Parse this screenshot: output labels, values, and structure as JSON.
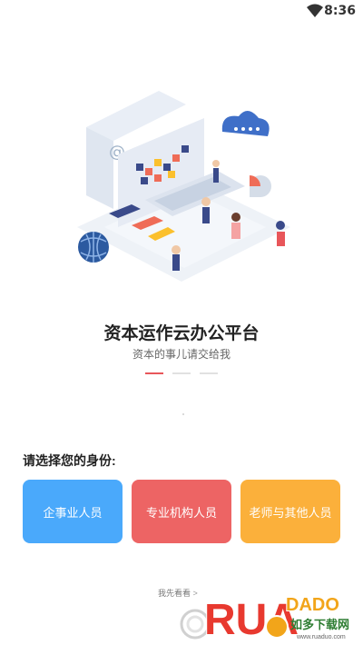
{
  "status_bar": {
    "time": "8:36",
    "wifi_icon": "wifi-icon"
  },
  "hero": {
    "title": "资本运作云办公平台",
    "subtitle": "资本的事儿请交给我"
  },
  "pager": {
    "count": 3,
    "active_index": 0
  },
  "identity": {
    "prompt": "请选择您的身份:",
    "options": [
      {
        "label": "企事业人员",
        "color": "#4aa9fb"
      },
      {
        "label": "专业机构人员",
        "color": "#ed6464"
      },
      {
        "label": "老师与其他人员",
        "color": "#fbb03b"
      }
    ]
  },
  "footer": {
    "skip_text": "我先看看",
    "skip_arrow": ">"
  },
  "watermark": {
    "brand": "RUANADAO",
    "sub": "如多下载网",
    "site": "www.ruaduo.com"
  },
  "colors": {
    "accent": "#e8565a",
    "indicator_inactive": "#e1e1e1"
  }
}
